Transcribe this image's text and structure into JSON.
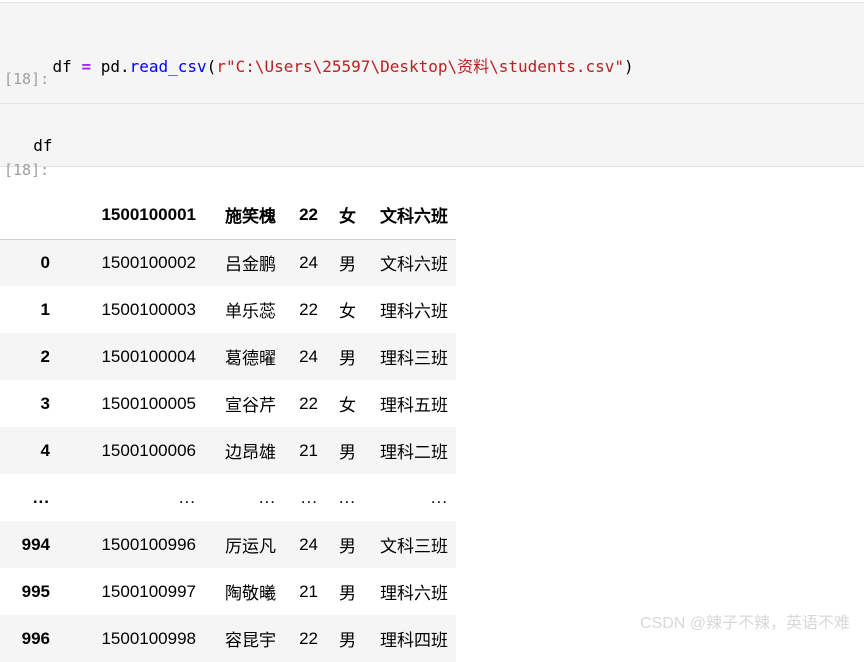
{
  "cells": [
    {
      "prompt": "",
      "source_tokens": [
        {
          "text": "df ",
          "kind": "plain"
        },
        {
          "text": "=",
          "kind": "op"
        },
        {
          "text": " pd.",
          "kind": "plain"
        },
        {
          "text": "read_csv",
          "kind": "fn"
        },
        {
          "text": "(",
          "kind": "plain"
        },
        {
          "text": "r\"C:\\Users\\25597\\Desktop\\资料\\students.csv\"",
          "kind": "str"
        },
        {
          "text": ")",
          "kind": "plain"
        }
      ],
      "source_text": "df = pd.read_csv(r\"C:\\Users\\25597\\Desktop\\资料\\students.csv\")"
    },
    {
      "prompt": "[18]:",
      "source_tokens": [
        {
          "text": "df",
          "kind": "plain"
        }
      ],
      "source_text": "df"
    }
  ],
  "output_prompt": "[18]:",
  "dataframe": {
    "header": {
      "index": "",
      "columns": [
        "1500100001",
        "施笑槐",
        "22",
        "女",
        "文科六班"
      ]
    },
    "rows": [
      {
        "index": "0",
        "cells": [
          "1500100002",
          "吕金鹏",
          "24",
          "男",
          "文科六班"
        ]
      },
      {
        "index": "1",
        "cells": [
          "1500100003",
          "单乐蕊",
          "22",
          "女",
          "理科六班"
        ]
      },
      {
        "index": "2",
        "cells": [
          "1500100004",
          "葛德曜",
          "24",
          "男",
          "理科三班"
        ]
      },
      {
        "index": "3",
        "cells": [
          "1500100005",
          "宣谷芹",
          "22",
          "女",
          "理科五班"
        ]
      },
      {
        "index": "4",
        "cells": [
          "1500100006",
          "边昂雄",
          "21",
          "男",
          "理科二班"
        ]
      },
      {
        "index": "...",
        "cells": [
          "...",
          "...",
          "...",
          "...",
          "..."
        ]
      },
      {
        "index": "994",
        "cells": [
          "1500100996",
          "厉运凡",
          "24",
          "男",
          "文科三班"
        ]
      },
      {
        "index": "995",
        "cells": [
          "1500100997",
          "陶敬曦",
          "21",
          "男",
          "理科六班"
        ]
      },
      {
        "index": "996",
        "cells": [
          "1500100998",
          "容昆宇",
          "22",
          "男",
          "理科四班"
        ]
      }
    ]
  },
  "watermark": "CSDN @辣子不辣，英语不难",
  "colors": {
    "cell_bg": "#f5f5f5",
    "stripe": "#f5f5f5",
    "prompt": "#a0a0a0",
    "string": "#ba2121",
    "function": "#0000ff",
    "operator": "#aa22ff",
    "watermark": "#d8d8d8"
  }
}
